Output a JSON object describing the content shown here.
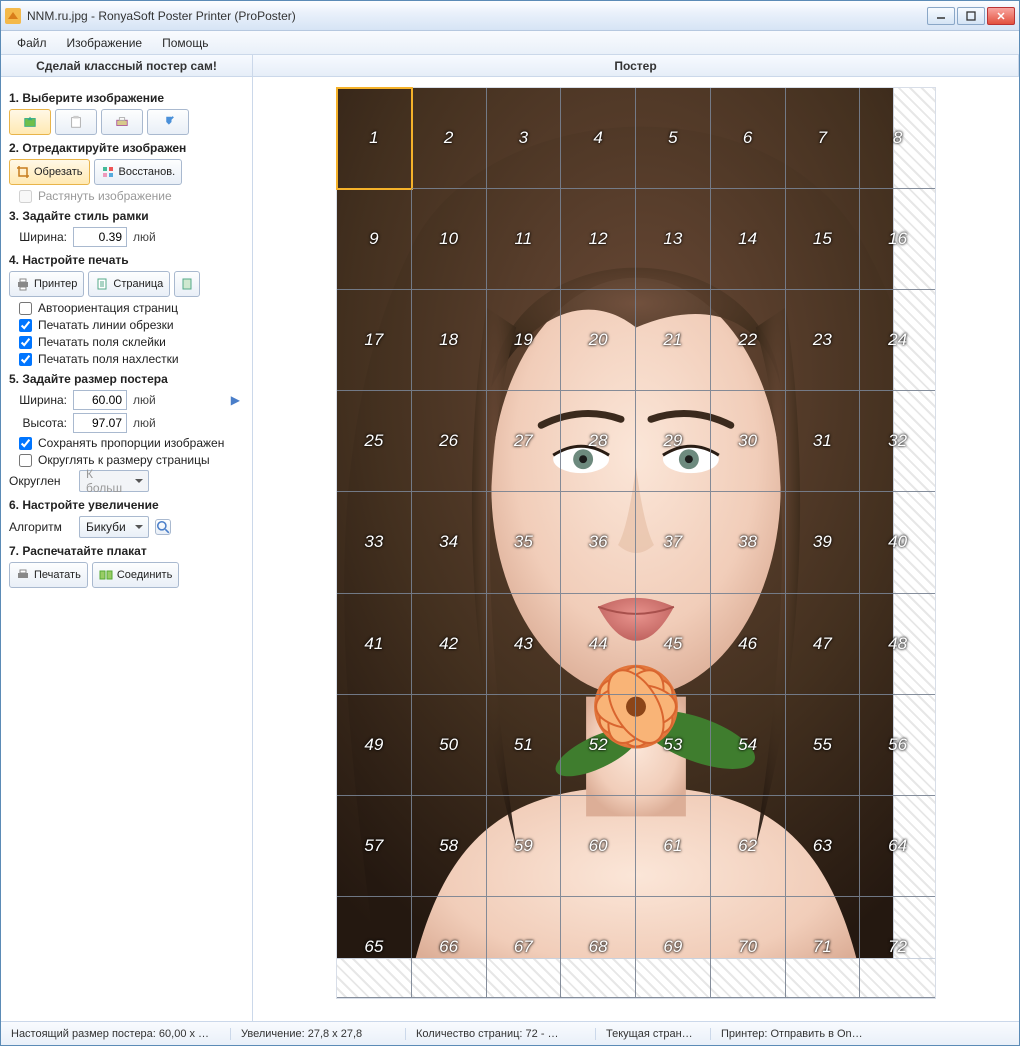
{
  "window": {
    "title": "NNM.ru.jpg - RonyaSoft Poster Printer (ProPoster)"
  },
  "menu": {
    "items": [
      "Файл",
      "Изображение",
      "Помощь"
    ]
  },
  "panels": {
    "left_title": "Сделай классный постер сам!",
    "right_title": "Постер"
  },
  "steps": {
    "s1": "1. Выберите изображение",
    "s2": "2. Отредактируйте изображен",
    "crop": "Обрезать",
    "restore": "Восстанов.",
    "stretch": "Растянуть изображение",
    "s3": "3. Задайте стиль рамки",
    "width_lbl": "Ширина:",
    "width_val": "0.39",
    "unit": "люй",
    "s4": "4. Настройте печать",
    "printer": "Принтер",
    "page": "Страница",
    "auto_orient": "Автоориентация страниц",
    "print_cut": "Печатать линии обрезки",
    "print_glue": "Печатать поля склейки",
    "print_overlap": "Печатать поля нахлестки",
    "s5": "5. Задайте размер постера",
    "pw_lbl": "Ширина:",
    "pw_val": "60.00",
    "ph_lbl": "Высота:",
    "ph_val": "97.07",
    "keep_ratio": "Сохранять пропорции изображен",
    "round_page": "Округлять к размеру страницы",
    "round_lbl": "Округлен",
    "round_val": "К больш",
    "s6": "6. Настройте увеличение",
    "algo_lbl": "Алгоритм",
    "algo_val": "Бикуби",
    "s7": "7. Распечатайте плакат",
    "print": "Печатать",
    "join": "Соединить"
  },
  "poster": {
    "cols": 8,
    "rows": 9,
    "total_pages": 72,
    "selected_cell": 1
  },
  "status": {
    "size": "Настоящий размер постера: 60,00 x …",
    "zoom": "Увеличение: 27,8 x 27,8",
    "pages": "Количество страниц: 72 - …",
    "current": "Текущая стран…",
    "printer": "Принтер: Отправить в On…"
  }
}
